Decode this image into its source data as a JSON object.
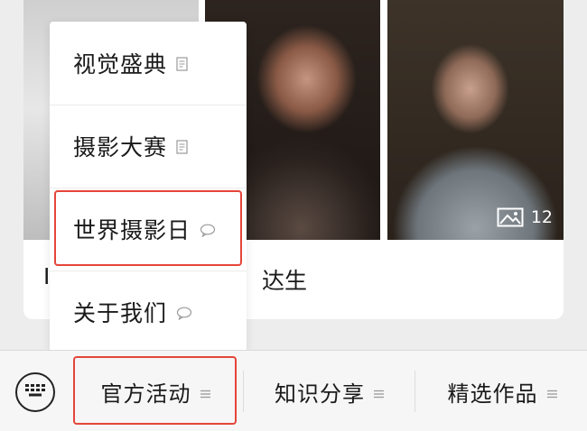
{
  "article": {
    "caption_start": "I",
    "caption_end": "达生",
    "photo_count": "12",
    "photos": [
      {
        "name": "left-photo"
      },
      {
        "name": "center-photo"
      },
      {
        "name": "right-photo"
      }
    ]
  },
  "popup_menu": {
    "items": [
      {
        "label": "视觉盛典",
        "icon": "document-icon"
      },
      {
        "label": "摄影大赛",
        "icon": "document-icon"
      },
      {
        "label": "世界摄影日",
        "icon": "chat-bubble-icon",
        "highlighted": true
      },
      {
        "label": "关于我们",
        "icon": "chat-bubble-icon"
      }
    ]
  },
  "bottom_bar": {
    "keyboard_icon": "keyboard-icon",
    "tabs": [
      {
        "label": "官方活动",
        "icon": "menu-lines-icon",
        "highlighted": true
      },
      {
        "label": "知识分享",
        "icon": "menu-lines-icon"
      },
      {
        "label": "精选作品",
        "icon": "menu-lines-icon"
      }
    ]
  },
  "colors": {
    "highlight": "#e5453a",
    "background": "#ededed",
    "bar": "#f6f6f6"
  }
}
